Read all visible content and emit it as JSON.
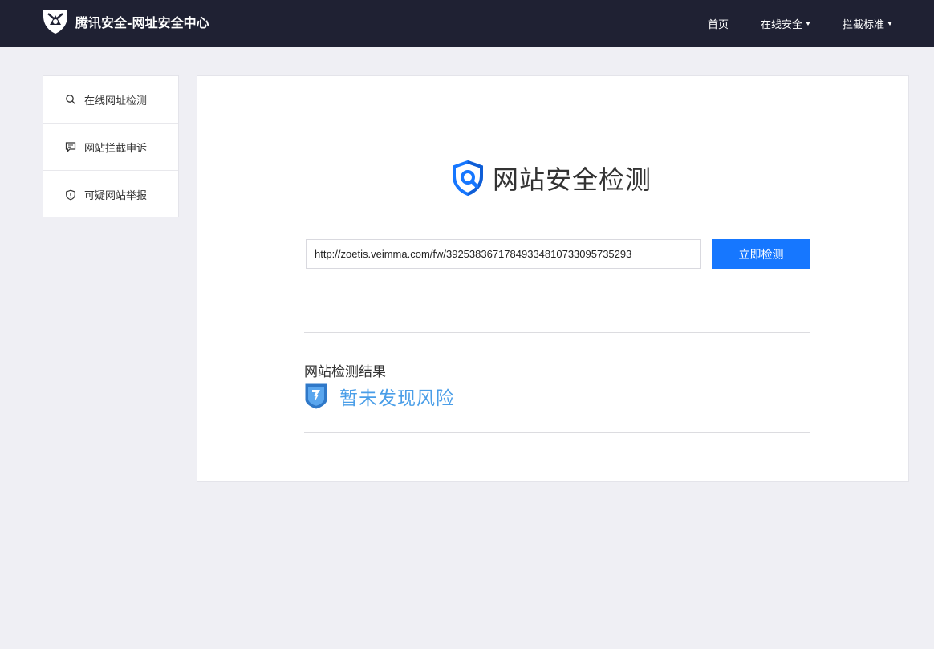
{
  "header": {
    "brand_title": "腾讯安全-网址安全中心",
    "nav": [
      {
        "label": "首页",
        "dropdown": false
      },
      {
        "label": "在线安全",
        "dropdown": true
      },
      {
        "label": "拦截标准",
        "dropdown": true
      }
    ]
  },
  "sidebar": {
    "items": [
      {
        "label": "在线网址检测",
        "icon": "search-icon"
      },
      {
        "label": "网站拦截申诉",
        "icon": "message-icon"
      },
      {
        "label": "可疑网站举报",
        "icon": "shield-alert-icon"
      }
    ]
  },
  "main": {
    "title": "网站安全检测",
    "url_value": "http://zoetis.veimma.com/fw/392538367178493348107330957352​93",
    "check_button": "立即检测",
    "result_label": "网站检测结果",
    "result_text": "暂未发现风险"
  },
  "colors": {
    "header_bg": "#1f2133",
    "accent": "#1677ff",
    "result_text": "#4a9ee8"
  }
}
